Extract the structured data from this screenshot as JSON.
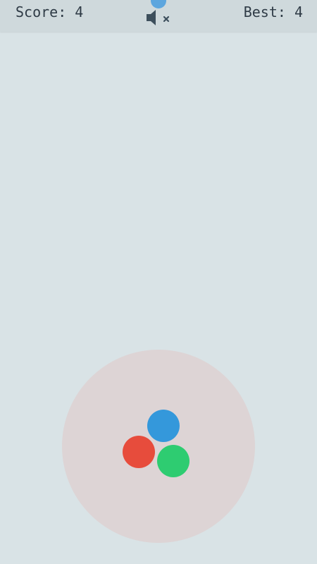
{
  "hud": {
    "score_text": "Score: 4",
    "best_text": "Best: 4",
    "mute_icon": "speaker-muted-icon"
  },
  "colors": {
    "background": "#d9e3e6",
    "topbar": "#cfd9dc",
    "text": "#2f3b46",
    "play_area": "#ddd4d5",
    "ball_blue": "#3498db",
    "ball_red": "#e74c3c",
    "ball_green": "#2ecc71",
    "falling_ball": "#5da6de",
    "icon": "#3d4f5c"
  }
}
